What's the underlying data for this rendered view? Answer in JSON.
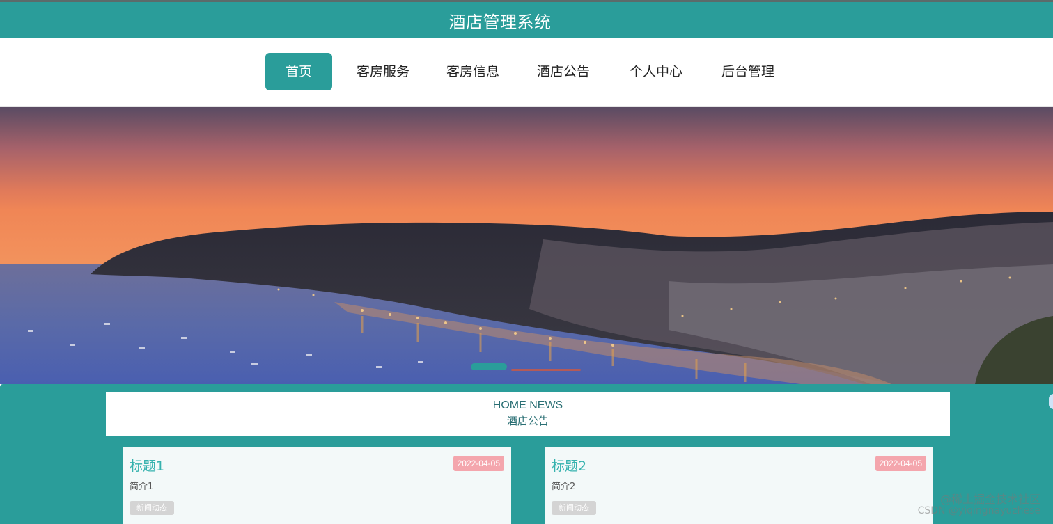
{
  "app": {
    "title": "酒店管理系统"
  },
  "nav": {
    "items": [
      {
        "label": "首页",
        "active": true
      },
      {
        "label": "客房服务",
        "active": false
      },
      {
        "label": "客房信息",
        "active": false
      },
      {
        "label": "酒店公告",
        "active": false
      },
      {
        "label": "个人中心",
        "active": false
      },
      {
        "label": "后台管理",
        "active": false
      }
    ]
  },
  "banner": {
    "image": "harbor-town-at-sunset",
    "slide_count": 2,
    "active_slide": 1
  },
  "news": {
    "heading_en": "HOME NEWS",
    "heading_cn": "酒店公告",
    "cards": [
      {
        "title": "标题1",
        "date": "2022-04-05",
        "brief": "简介1",
        "tag": "新闻动态"
      },
      {
        "title": "标题2",
        "date": "2022-04-05",
        "brief": "简介2",
        "tag": "新闻动态"
      }
    ]
  },
  "watermark": {
    "line1": "@稀土掘金技术社区",
    "line2": "CSDN @yiqingnayuzhese"
  },
  "colors": {
    "accent": "#2a9d9a",
    "date_badge": "#f4a6ad",
    "title_text": "#35b2ae"
  }
}
